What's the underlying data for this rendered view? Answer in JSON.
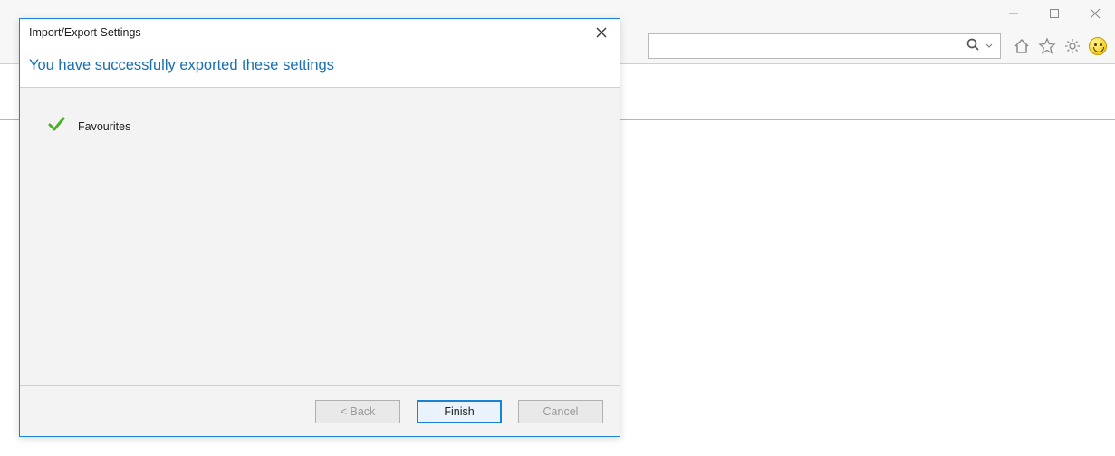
{
  "dialog": {
    "title": "Import/Export Settings",
    "heading": "You have successfully exported these settings",
    "items": [
      {
        "label": "Favourites"
      }
    ],
    "buttons": {
      "back": "< Back",
      "finish": "Finish",
      "cancel": "Cancel"
    }
  },
  "browser": {
    "window_controls": {
      "minimize": "—",
      "maximize": "▢",
      "close": "✕"
    }
  }
}
